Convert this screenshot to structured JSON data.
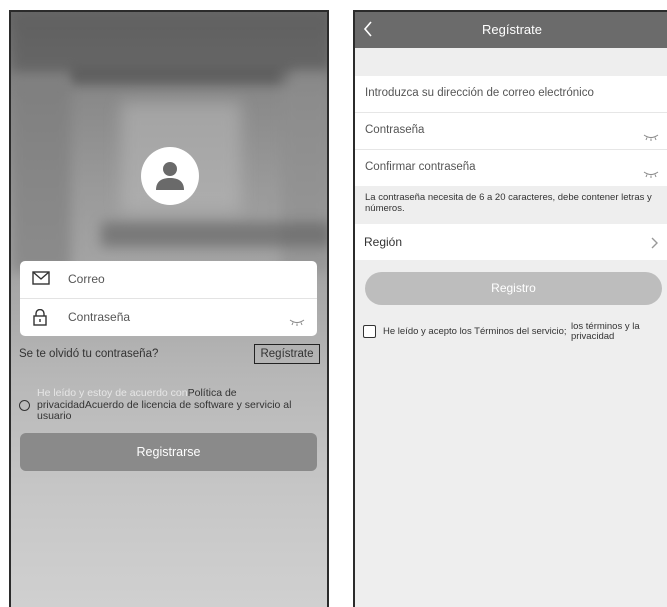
{
  "login_screen": {
    "email_placeholder": "Correo",
    "password_placeholder": "Contraseña",
    "forgot_password": "Se te olvidó tu contraseña?",
    "register_link": "Regístrate",
    "agreement_part1": "He leído y estoy de acuerdo con",
    "agreement_part2": "Política de privacidad",
    "agreement_part3": "Acuerdo de licencia de software y servicio al usuario",
    "register_button": "Registrarse"
  },
  "register_screen": {
    "title": "Regístrate",
    "email_placeholder": "Introduzca su dirección de correo electrónico",
    "password_placeholder": "Contraseña",
    "confirm_placeholder": "Confirmar contraseña",
    "password_hint": "La contraseña necesita de 6 a 20 caracteres, debe contener letras y números.",
    "region_label": "Región",
    "submit_button": "Registro",
    "terms_text": "He leído y acepto los Términos del servicio;",
    "terms_text2": "los términos y la privacidad"
  },
  "icons": [
    "user-avatar-icon",
    "envelope-icon",
    "lock-icon",
    "eye-closed-icon",
    "back-arrow-icon",
    "chevron-right-icon"
  ],
  "colors": {
    "header": "#6b6b6b",
    "button_dark": "#8a8a8a",
    "button_disabled": "#bdbdbd",
    "background": "#eeeeee"
  }
}
